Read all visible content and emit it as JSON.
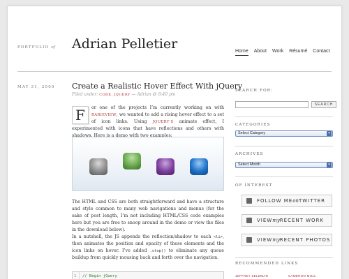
{
  "header": {
    "portfolio_prefix": "PORTFOLIO",
    "portfolio_suffix": "of",
    "site_title": "Adrian Pelletier",
    "nav": [
      "Home",
      "About",
      "Work",
      "Résumé",
      "Contact"
    ],
    "active_nav": "Home"
  },
  "post": {
    "date": "MAY 31, 2009",
    "title": "Create a Realistic Hover Effect With jQuery",
    "filed_prefix": "Filed under:",
    "categories": [
      "CODE",
      "JQUERY"
    ],
    "author_line": "— Adrian @ 8:40 pm",
    "dropcap": "F",
    "p1_a": "or one of the projects I’m currently working on with ",
    "p1_link1": "RARIEVIEW",
    "p1_b": ", we wanted to add a rising hover effect to a set of icon links. Using ",
    "p1_link2": "JQUERY’S",
    "p1_c": " animate effect, I experimented with icons that have reflections and others with shadows. Here is a demo with two examples:",
    "p2": "The HTML and CSS are both straightforward and have a structure and style common to many web navigations and menus (for the sake of post length, I’m not including HTML/CSS code examples here but you are free to snoop around in the demo or view the files in the download below).",
    "p3_a": "In a nutshell, the JS appends the reflection/shadow to each ",
    "p3_code1": "<li>",
    "p3_b": ", then animates the position and opacity of these elements and the icon links on hover. I’ve added ",
    "p3_code2": ".stop()",
    "p3_c": " to eliminate any queue buildup from quickly mousing back and forth over the navigation.",
    "code_line_no": "1",
    "code_line": "// Begin jQuery"
  },
  "sidebar": {
    "search_label": "SEARCH FOR:",
    "search_button": "SEARCH",
    "categories_label": "CATEGORIES",
    "categories_select": "Select Category",
    "archives_label": "ARCHIVES",
    "archives_select": "Select Month",
    "interest_label": "OF INTEREST",
    "btn1_a": "FOLLOW ME ",
    "btn1_b": "on",
    "btn1_c": " TWITTER",
    "btn2_a": "VIEW ",
    "btn2_b": "my",
    "btn2_c": " RECENT WORK",
    "btn3_a": "VIEW ",
    "btn3_b": "my",
    "btn3_c": " RECENT PHOTOS",
    "recommended_label": "RECOMMENDED LINKS",
    "rec1": "JEFFREY ZELDMAN",
    "rec2": "CAMERON MOLL"
  },
  "colors": {
    "link_red": "#aa3333",
    "demo_icons": [
      "#8d8d8d",
      "#6aa84f",
      "#7c3f9e",
      "#1e73c9"
    ]
  }
}
